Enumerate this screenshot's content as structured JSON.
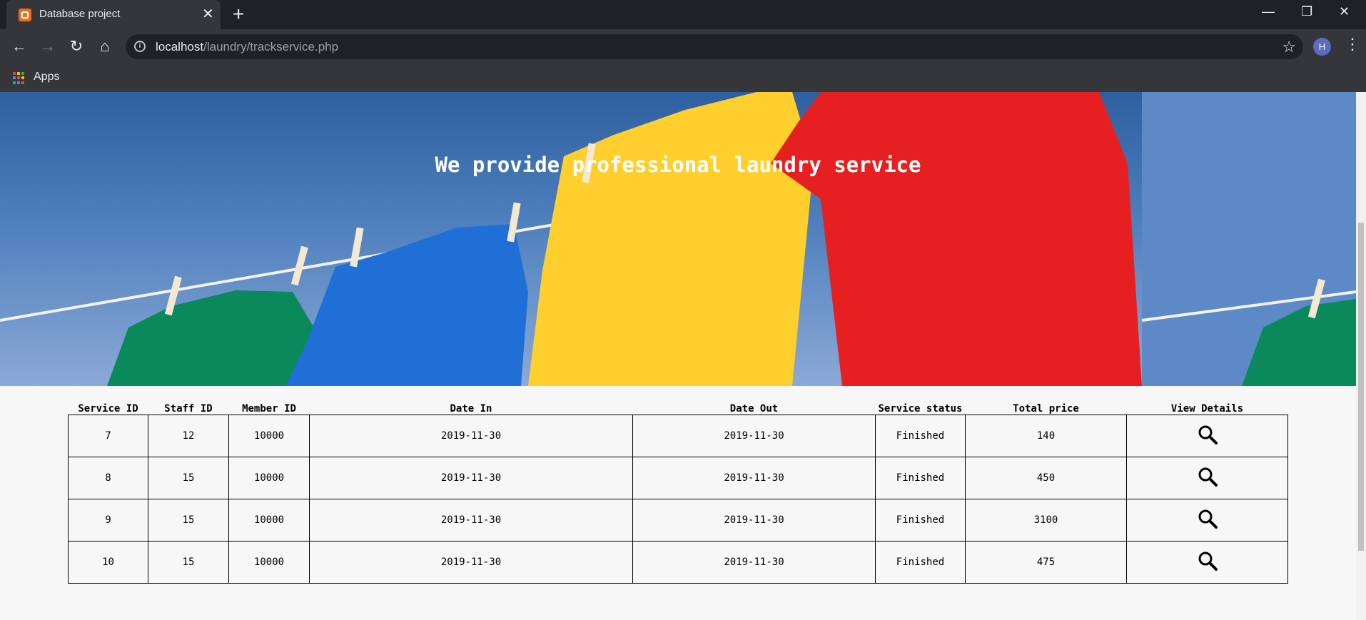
{
  "browser": {
    "tab_title": "Database project",
    "url_host": "localhost",
    "url_path": "/laundry/trackservice.php",
    "profile_initial": "H",
    "bookmarks_label": "Apps"
  },
  "hero": {
    "heading": "We provide professional laundry service"
  },
  "table": {
    "headers": [
      "Service ID",
      "Staff ID",
      "Member ID",
      "Date In",
      "Date Out",
      "Service status",
      "Total price",
      "View Details"
    ],
    "rows": [
      [
        "7",
        "12",
        "10000",
        "2019-11-30",
        "2019-11-30",
        "Finished",
        "140"
      ],
      [
        "8",
        "15",
        "10000",
        "2019-11-30",
        "2019-11-30",
        "Finished",
        "450"
      ],
      [
        "9",
        "15",
        "10000",
        "2019-11-30",
        "2019-11-30",
        "Finished",
        "3100"
      ],
      [
        "10",
        "15",
        "10000",
        "2019-11-30",
        "2019-11-30",
        "Finished",
        "475"
      ]
    ]
  },
  "icons": {
    "view_details": "magnifier-icon"
  },
  "colors": {
    "tshirt_green": "#0a8a5a",
    "tshirt_blue": "#1f6fd6",
    "tshirt_yellow": "#ffcf2e",
    "tshirt_red": "#e62020"
  }
}
